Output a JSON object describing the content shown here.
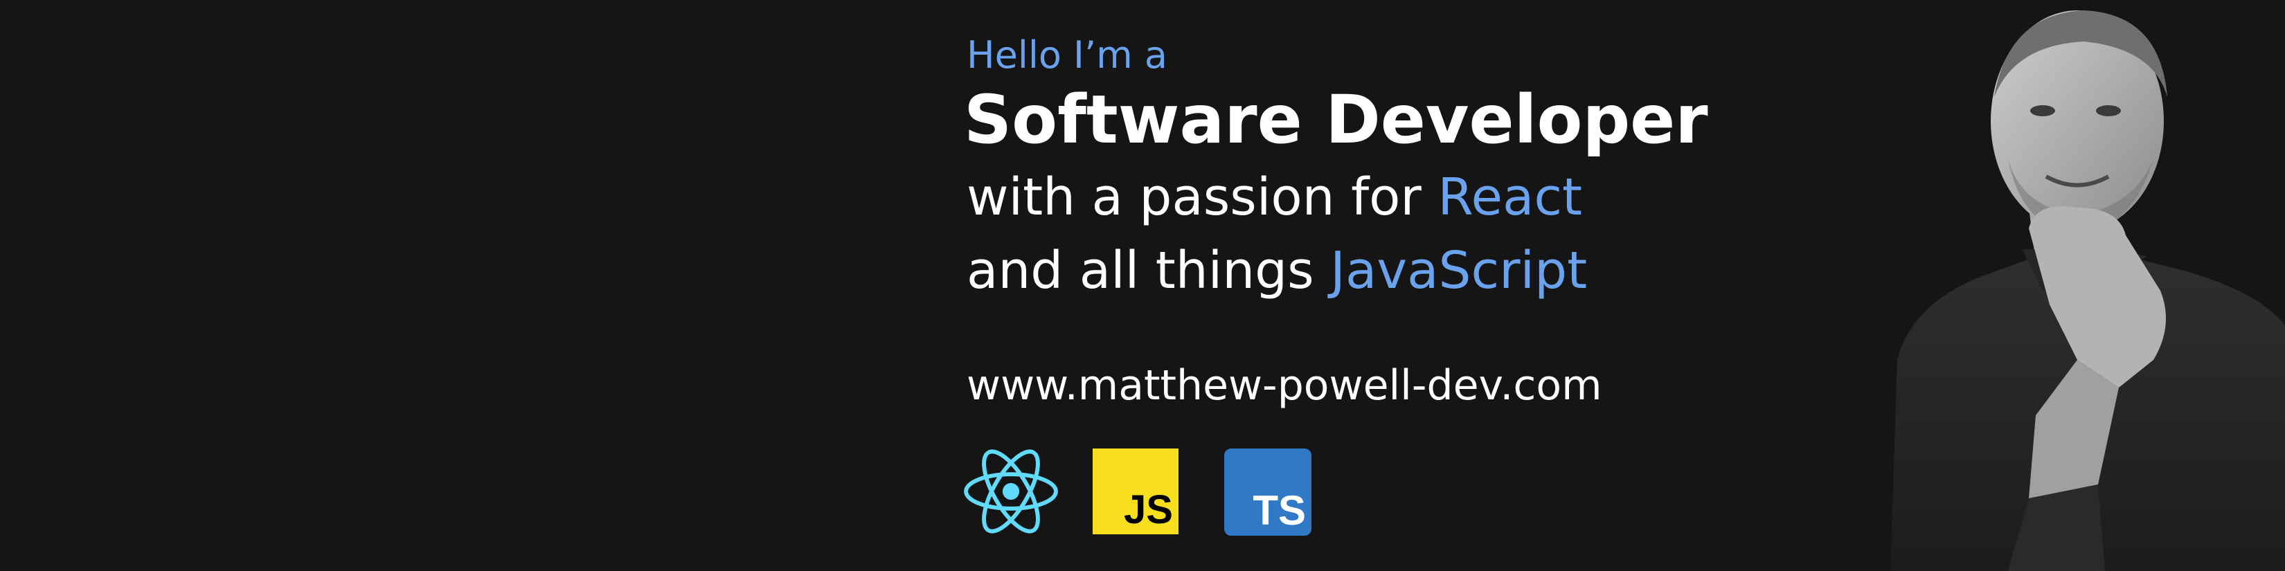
{
  "intro": "Hello I’m a",
  "headline": "Software Developer",
  "tagline": {
    "line1_prefix": "with a passion for ",
    "line1_highlight": "React",
    "line2_prefix": "and all things ",
    "line2_highlight": "JavaScript"
  },
  "website": "www.matthew-powell-dev.com",
  "logos": {
    "react": {
      "icon": "react-atom-icon",
      "color": "#61dafb"
    },
    "javascript": {
      "label": "JS",
      "background": "#f7df1e"
    },
    "typescript": {
      "label": "TS",
      "background": "#3178c6"
    }
  },
  "colors": {
    "background": "#151515",
    "accent": "#6aa2ee",
    "text": "#ffffff"
  },
  "portrait": {
    "description_icon": "person-portrait-photo"
  }
}
